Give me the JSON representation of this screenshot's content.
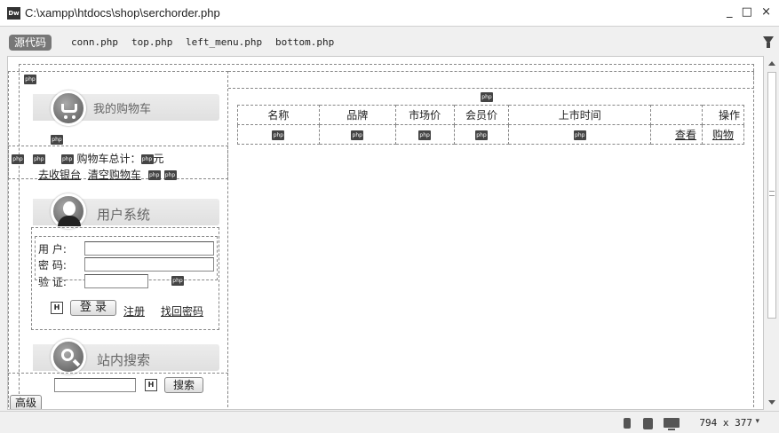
{
  "window": {
    "title": "C:\\xampp\\htdocs\\shop\\serchorder.php",
    "app_icon": "Dw",
    "controls": "_ □ ×"
  },
  "filebar": {
    "source_label": "源代码",
    "files": [
      "conn.php",
      "top.php",
      "left_menu.php",
      "bottom.php"
    ]
  },
  "sidebar": {
    "cart": {
      "title": "我的购物车",
      "total_label": "购物车总计：",
      "unit": "元",
      "checkout_link": "去收银台",
      "clear_link": "清空购物车"
    },
    "user": {
      "title": "用户系统",
      "username_label": "用 户:",
      "password_label": "密 码:",
      "code_label": "验 证:",
      "login_button": "登 录",
      "register_link": "注册",
      "recover_link": "找回密码"
    },
    "search": {
      "title": "站内搜索",
      "search_button": "搜索",
      "advanced_button": "高级"
    }
  },
  "table": {
    "headers": [
      "名称",
      "品牌",
      "市场价",
      "会员价",
      "上市时间",
      "",
      "操作"
    ],
    "actions": [
      "查看",
      "购物"
    ]
  },
  "php_marker": "php",
  "statusbar": {
    "size": "794 x 377"
  }
}
